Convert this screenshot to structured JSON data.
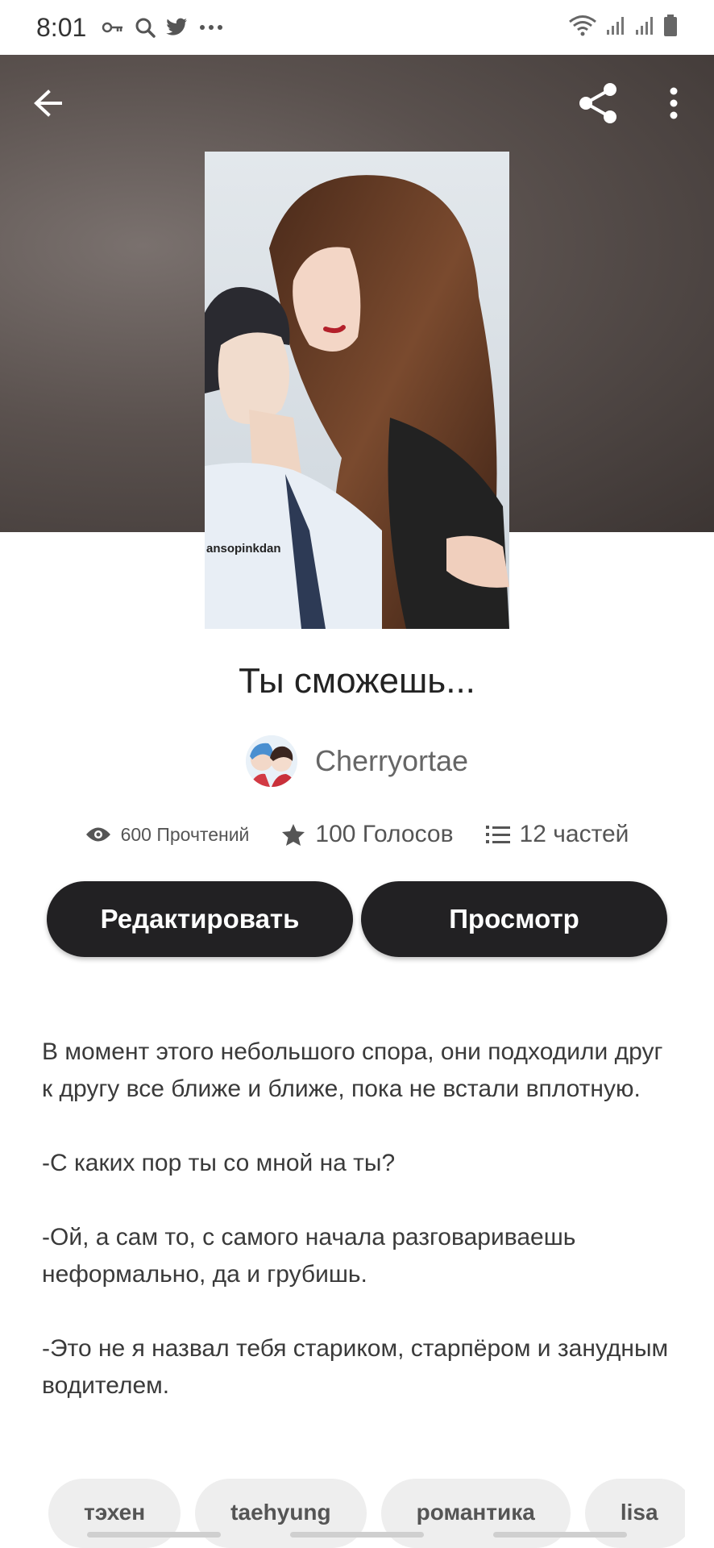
{
  "status_bar": {
    "time": "8:01",
    "left_icons": [
      "key-icon",
      "search-icon",
      "twitter-icon",
      "more-dots-icon"
    ],
    "right_icons": [
      "wifi-icon",
      "signal-icon",
      "signal-icon",
      "battery-icon"
    ]
  },
  "topbar": {
    "back_icon": "arrow-left-icon",
    "share_icon": "share-icon",
    "menu_icon": "more-vertical-icon"
  },
  "cover": {
    "caption": "ansopinkdan"
  },
  "story": {
    "title": "Ты сможешь...",
    "author": "Cherryortae",
    "reads": "600 Прочтений",
    "votes": "100 Голосов",
    "parts": "12 частей"
  },
  "actions": {
    "edit_label": "Редактировать",
    "preview_label": "Просмотр"
  },
  "description": [
    "В момент этого небольшого спора, они подходили друг к другу все ближе и ближе, пока не встали вплотную.",
    "-С каких пор ты со мной на ты?",
    "-Ой, а сам то, с самого начала разговариваешь неформально, да и грубишь.",
    "-Это не я назвал тебя стариком, старпёром и занудным водителем."
  ],
  "tags": [
    "тэхен",
    "taehyung",
    "романтика",
    "lisa"
  ],
  "colors": {
    "button_bg": "#222123",
    "hero_bg": "#4a4240",
    "tag_bg": "#eeeeee"
  }
}
